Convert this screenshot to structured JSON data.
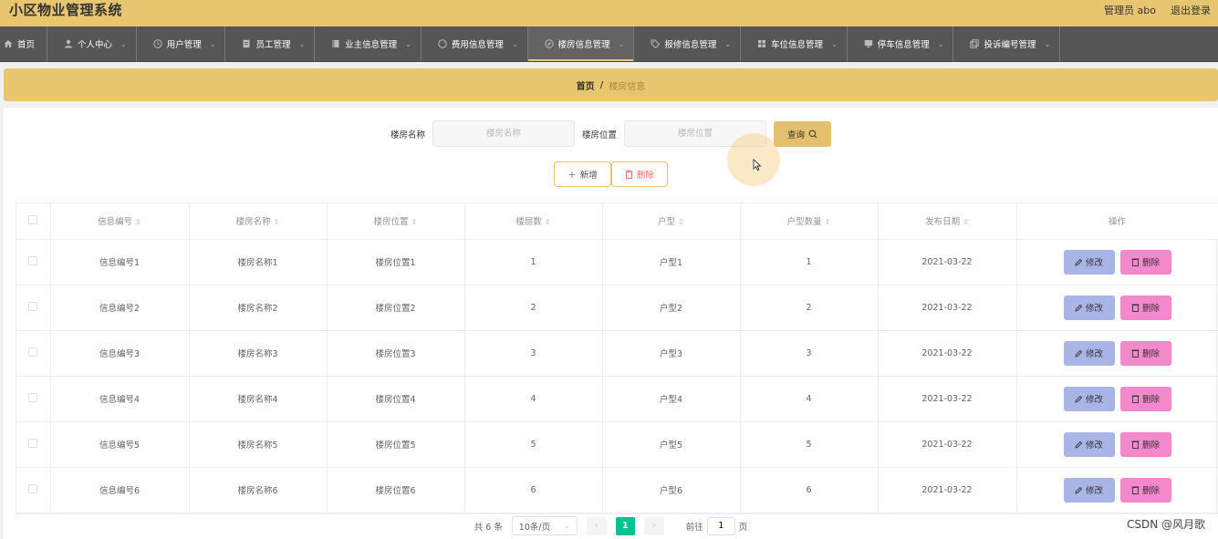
{
  "header": {
    "title": "小区物业管理系统",
    "user_label": "管理员 abo",
    "logout_label": "退出登录"
  },
  "nav": {
    "items": [
      {
        "label": "首页",
        "icon": "home-icon",
        "has_menu": false
      },
      {
        "label": "个人中心",
        "icon": "user-icon",
        "has_menu": true
      },
      {
        "label": "用户管理",
        "icon": "clock-icon",
        "has_menu": true
      },
      {
        "label": "员工管理",
        "icon": "document-icon",
        "has_menu": true
      },
      {
        "label": "业主信息管理",
        "icon": "book-icon",
        "has_menu": true
      },
      {
        "label": "费用信息管理",
        "icon": "gauge-icon",
        "has_menu": true
      },
      {
        "label": "楼房信息管理",
        "icon": "compass-icon",
        "has_menu": true,
        "active": true
      },
      {
        "label": "报修信息管理",
        "icon": "tag-icon",
        "has_menu": true
      },
      {
        "label": "车位信息管理",
        "icon": "grid-icon",
        "has_menu": true
      },
      {
        "label": "停车信息管理",
        "icon": "monitor-icon",
        "has_menu": true
      },
      {
        "label": "投诉编号管理",
        "icon": "copy-icon",
        "has_menu": true
      }
    ]
  },
  "breadcrumb": {
    "home": "首页",
    "separator": "/",
    "current": "楼房信息"
  },
  "search": {
    "name_label": "楼房名称",
    "name_placeholder": "楼房名称",
    "location_label": "楼房位置",
    "location_placeholder": "楼房位置",
    "query_label": "查询"
  },
  "actions": {
    "add_label": "新增",
    "delete_label": "删除"
  },
  "table": {
    "columns": [
      "信息编号",
      "楼房名称",
      "楼房位置",
      "楼层数",
      "户型",
      "户型数量",
      "发布日期",
      "操作"
    ],
    "edit_label": "修改",
    "delete_label": "删除",
    "rows": [
      [
        "信息编号1",
        "楼房名称1",
        "楼房位置1",
        "1",
        "户型1",
        "1",
        "2021-03-22"
      ],
      [
        "信息编号2",
        "楼房名称2",
        "楼房位置2",
        "2",
        "户型2",
        "2",
        "2021-03-22"
      ],
      [
        "信息编号3",
        "楼房名称3",
        "楼房位置3",
        "3",
        "户型3",
        "3",
        "2021-03-22"
      ],
      [
        "信息编号4",
        "楼房名称4",
        "楼房位置4",
        "4",
        "户型4",
        "4",
        "2021-03-22"
      ],
      [
        "信息编号5",
        "楼房名称5",
        "楼房位置5",
        "5",
        "户型5",
        "5",
        "2021-03-22"
      ],
      [
        "信息编号6",
        "楼房名称6",
        "楼房位置6",
        "6",
        "户型6",
        "6",
        "2021-03-22"
      ]
    ]
  },
  "pagination": {
    "total": "共 6 条",
    "page_size": "10条/页",
    "current_page": "1",
    "goto_prefix": "前往",
    "goto_value": "1",
    "goto_suffix": "页"
  },
  "watermark": "CSDN @风月歌",
  "colors": {
    "header_bg": "#e8c66f",
    "nav_bg": "#565656",
    "accent": "#00c292",
    "edit_btn": "#a9b5e6",
    "delete_btn": "#f488cd"
  }
}
